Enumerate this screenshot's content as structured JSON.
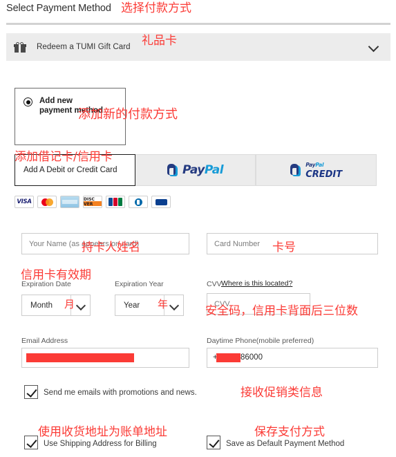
{
  "header": {
    "title": "Select Payment Method",
    "note": "选择付款方式"
  },
  "giftcard": {
    "label": "Redeem a TUMI Gift Card",
    "note": "礼品卡",
    "icon": "gift-icon",
    "chevron": "chevron-down-icon"
  },
  "new_payment": {
    "radio_label": "Add new payment method",
    "note": "添加新的付款方式",
    "selected": true
  },
  "tabs": [
    {
      "label": "Add A Debit or Credit Card",
      "note": "添加借记卡/信用卡",
      "active": true
    },
    {
      "label": "PayPal",
      "logo_top": "Pay",
      "logo_bottom": "Pal",
      "active": false
    },
    {
      "label": "PayPal CREDIT",
      "logo_top_a": "Pay",
      "logo_top_b": "Pal",
      "logo_bottom": "CREDIT",
      "active": false
    }
  ],
  "card_logos": [
    {
      "name": "visa-logo",
      "text": "VISA"
    },
    {
      "name": "mastercard-logo",
      "text": ""
    },
    {
      "name": "amex-logo",
      "text": ""
    },
    {
      "name": "discover-logo",
      "text": "DISC VER"
    },
    {
      "name": "jcb-logo",
      "text": ""
    },
    {
      "name": "diners-club-logo",
      "text": ""
    },
    {
      "name": "maestro-logo",
      "text": ""
    }
  ],
  "form": {
    "name": {
      "placeholder": "Your Name (as appears on card)",
      "value": "",
      "note": "持卡人姓名"
    },
    "card_number": {
      "placeholder": "Card Number",
      "value": "",
      "note": "卡号"
    },
    "expiration_date": {
      "label": "Expiration Date",
      "value": "Month",
      "note_label": "信用卡有效期",
      "note_value": "月"
    },
    "expiration_year": {
      "label": "Expiration Year",
      "value": "Year",
      "note_value": "年"
    },
    "cvv": {
      "label": "CVV",
      "link": "Where is this located?",
      "placeholder": "CVV",
      "value": "",
      "note": "安全码，信用卡背面后三位数"
    },
    "email": {
      "label": "Email Address",
      "value": "",
      "redacted": true
    },
    "phone": {
      "label": "Daytime Phone(mobile preferred)",
      "value": "86000",
      "prefix_redacted": true
    }
  },
  "checkboxes": [
    {
      "label": "Send me emails with promotions and news.",
      "note": "接收促销类信息",
      "checked": true
    },
    {
      "label": "Use Shipping Address for Billing",
      "note": "使用收货地址为账单地址",
      "checked": true
    },
    {
      "label": "Save as Default Payment Method",
      "note": "保存支付方式",
      "checked": true
    }
  ],
  "colors": {
    "annotation": "#fb3b36",
    "accordion_bg": "#ececec",
    "paypal_dark": "#253b80",
    "paypal_light": "#179bd7"
  }
}
